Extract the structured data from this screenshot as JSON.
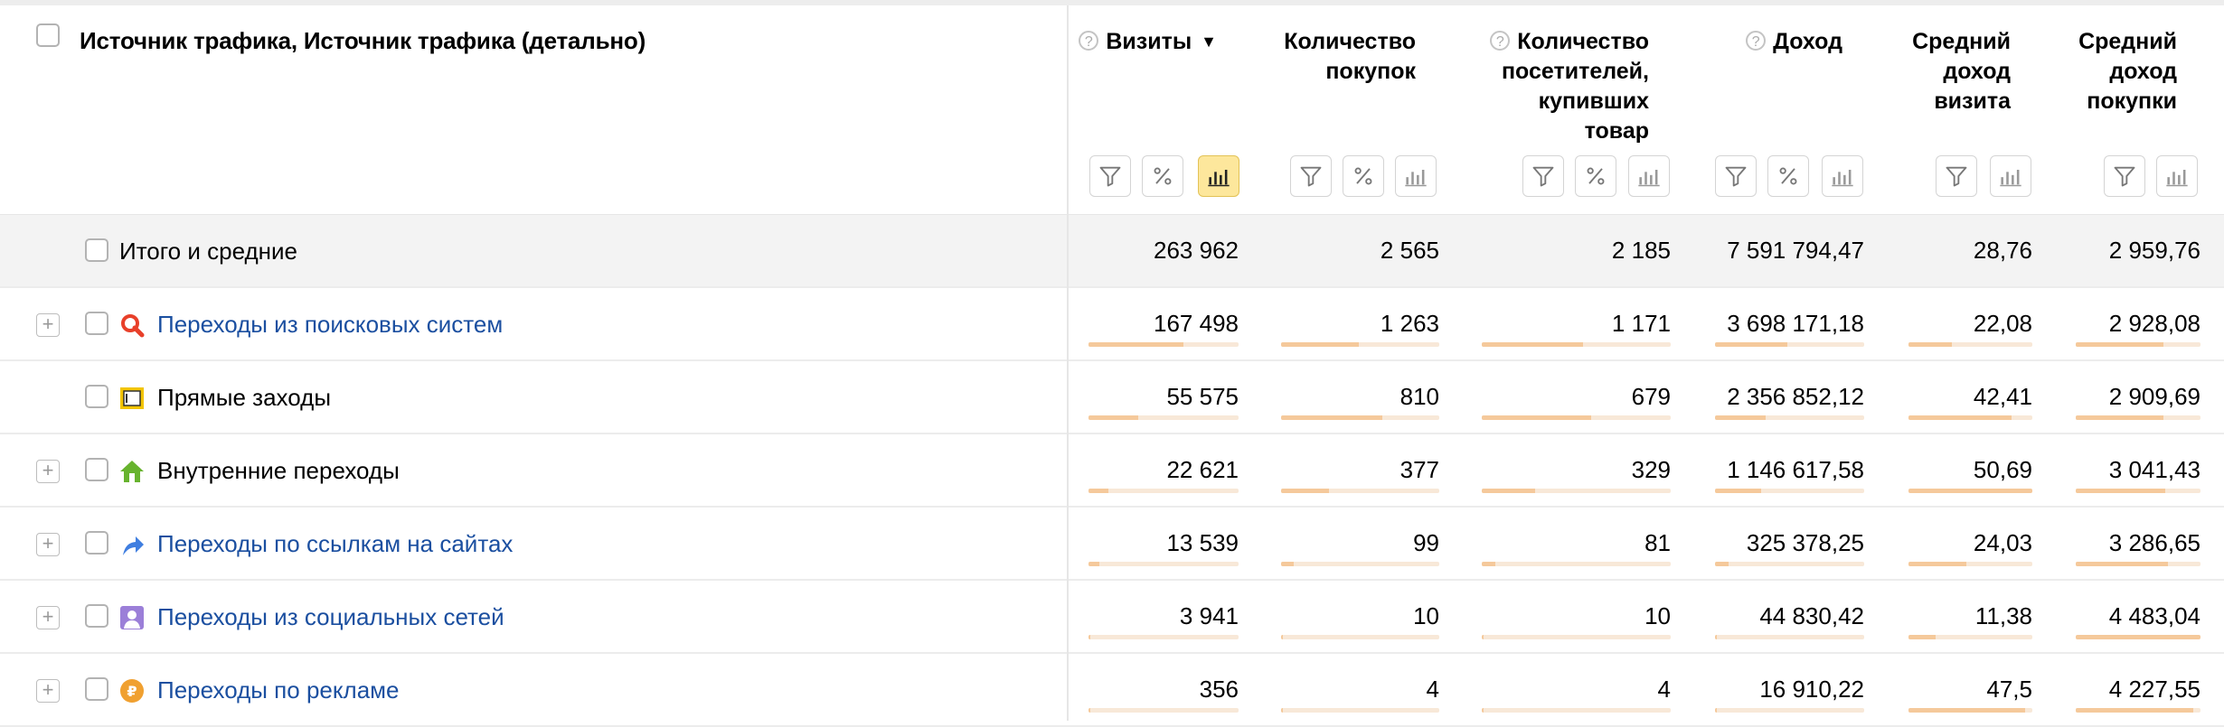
{
  "header": {
    "dimension_title": "Источник трафика, Источник трафика (детально)",
    "columns": [
      {
        "key": "visits",
        "label_lines": [
          "Визиты"
        ],
        "help": true,
        "sort": "▼",
        "tools": [
          "filter",
          "percent",
          "chart"
        ],
        "chart_active": true
      },
      {
        "key": "purchases",
        "label_lines": [
          "Количество",
          "покупок"
        ],
        "help": false,
        "tools": [
          "filter",
          "percent",
          "chart"
        ]
      },
      {
        "key": "buyers",
        "label_lines": [
          "Количество",
          "посетителей,",
          "купивших",
          "товар"
        ],
        "help": true,
        "tools": [
          "filter",
          "percent",
          "chart"
        ]
      },
      {
        "key": "revenue",
        "label_lines": [
          "Доход"
        ],
        "help": true,
        "tools": [
          "filter",
          "percent",
          "chart"
        ]
      },
      {
        "key": "avg_visit",
        "label_lines": [
          "Средний",
          "доход",
          "визита"
        ],
        "help": false,
        "tools": [
          "filter",
          "chart"
        ]
      },
      {
        "key": "avg_purchase",
        "label_lines": [
          "Средний",
          "доход",
          "покупки"
        ],
        "help": false,
        "tools": [
          "filter",
          "chart"
        ]
      }
    ],
    "help_glyph": "?"
  },
  "total": {
    "label": "Итого и средние",
    "values": [
      "263 962",
      "2 565",
      "2 185",
      "7 591 794,47",
      "28,76",
      "2 959,76"
    ]
  },
  "rows": [
    {
      "label": "Переходы из поисковых систем",
      "link": true,
      "expandable": true,
      "icon": "search-engine-icon",
      "icon_color": "#e8402a",
      "values": [
        "167 498",
        "1 263",
        "1 171",
        "3 698 171,18",
        "22,08",
        "2 928,08"
      ],
      "bars": [
        0.635,
        0.492,
        0.536,
        0.487,
        0.35,
        0.7
      ]
    },
    {
      "label": "Прямые заходы",
      "link": false,
      "expandable": false,
      "icon": "direct-visit-icon",
      "icon_color": "#f2c400",
      "values": [
        "55 575",
        "810",
        "679",
        "2 356 852,12",
        "42,41",
        "2 909,69"
      ],
      "bars": [
        0.33,
        0.64,
        0.58,
        0.34,
        0.83,
        0.7
      ]
    },
    {
      "label": "Внутренние переходы",
      "link": false,
      "expandable": true,
      "icon": "internal-home-icon",
      "icon_color": "#67b32e",
      "values": [
        "22 621",
        "377",
        "329",
        "1 146 617,58",
        "50,69",
        "3 041,43"
      ],
      "bars": [
        0.13,
        0.3,
        0.28,
        0.31,
        1.0,
        0.72
      ]
    },
    {
      "label": "Переходы по ссылкам на сайтах",
      "link": true,
      "expandable": true,
      "icon": "link-arrow-icon",
      "icon_color": "#3f7ee0",
      "values": [
        "13 539",
        "99",
        "81",
        "325 378,25",
        "24,03",
        "3 286,65"
      ],
      "bars": [
        0.07,
        0.08,
        0.07,
        0.09,
        0.47,
        0.74
      ]
    },
    {
      "label": "Переходы из социальных сетей",
      "link": true,
      "expandable": true,
      "icon": "social-user-icon",
      "icon_color": "#9b7fd8",
      "values": [
        "3 941",
        "10",
        "10",
        "44 830,42",
        "11,38",
        "4 483,04"
      ],
      "bars": [
        0.015,
        0.008,
        0.008,
        0.012,
        0.22,
        1.0
      ]
    },
    {
      "label": "Переходы по рекламе",
      "link": true,
      "expandable": true,
      "icon": "ad-coin-icon",
      "icon_color": "#f0a030",
      "values": [
        "356",
        "4",
        "4",
        "16 910,22",
        "47,5",
        "4 227,55"
      ],
      "bars": [
        0.003,
        0.003,
        0.003,
        0.005,
        0.94,
        0.94
      ]
    }
  ]
}
